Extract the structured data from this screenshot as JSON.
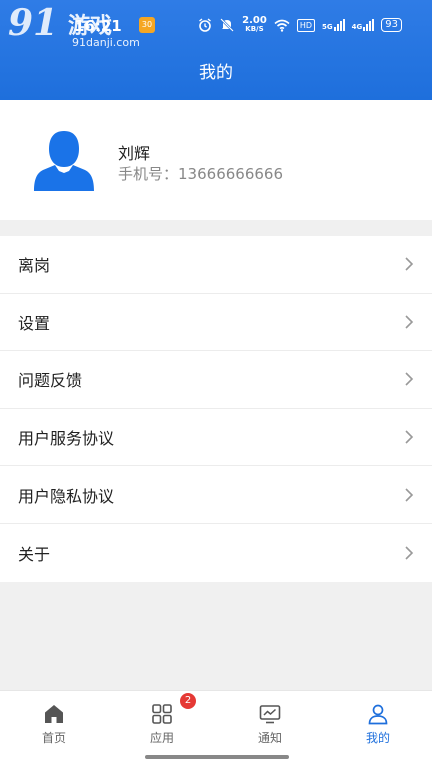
{
  "statusbar": {
    "watermark_big": "91",
    "watermark_cn": "游戏",
    "watermark_url": "91danji.com",
    "time": "16:21",
    "app_badge": "30",
    "speed_value": "2.00",
    "speed_unit": "KB/S",
    "hd": "HD",
    "net1": "5G",
    "net2": "4G",
    "battery": "93"
  },
  "header": {
    "title": "我的"
  },
  "profile": {
    "name": "刘辉",
    "phone_label": "手机号：",
    "phone_value": "13666666666"
  },
  "menu": {
    "items": [
      {
        "label": "离岗"
      },
      {
        "label": "设置"
      },
      {
        "label": "问题反馈"
      },
      {
        "label": "用户服务协议"
      },
      {
        "label": "用户隐私协议"
      },
      {
        "label": "关于"
      }
    ]
  },
  "tabbar": {
    "tabs": [
      {
        "label": "首页",
        "icon": "home-icon"
      },
      {
        "label": "应用",
        "icon": "apps-grid-icon"
      },
      {
        "label": "通知",
        "icon": "monitor-icon"
      },
      {
        "label": "我的",
        "icon": "person-icon"
      }
    ],
    "apps_badge": "2",
    "active_index": 3
  },
  "colors": {
    "primary": "#1e6fdc",
    "badge": "#e53935",
    "avatar": "#1a73e8"
  }
}
